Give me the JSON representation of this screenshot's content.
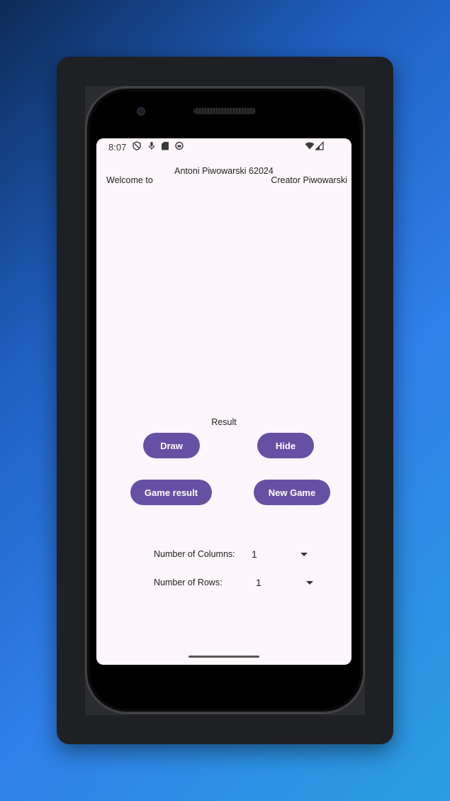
{
  "status_bar": {
    "time": "8:07",
    "left_icons": [
      "shield-icon",
      "microphone-icon",
      "sd-card-icon",
      "app-circle-icon"
    ],
    "right_icons": [
      "wifi-icon",
      "signal-icon"
    ]
  },
  "header": {
    "title": "Antoni Piwowarski 62024",
    "welcome": "Welcome to",
    "creator": "Creator Piwowarski"
  },
  "result": {
    "label": "Result"
  },
  "buttons": {
    "draw": "Draw",
    "hide": "Hide",
    "game_result": "Game result",
    "new_game": "New Game"
  },
  "settings": {
    "columns_label": "Number of Columns:",
    "columns_value": "1",
    "rows_label": "Number of Rows:",
    "rows_value": "1"
  },
  "colors": {
    "accent": "#6750a4",
    "screen_background": "#fdf6fb"
  }
}
